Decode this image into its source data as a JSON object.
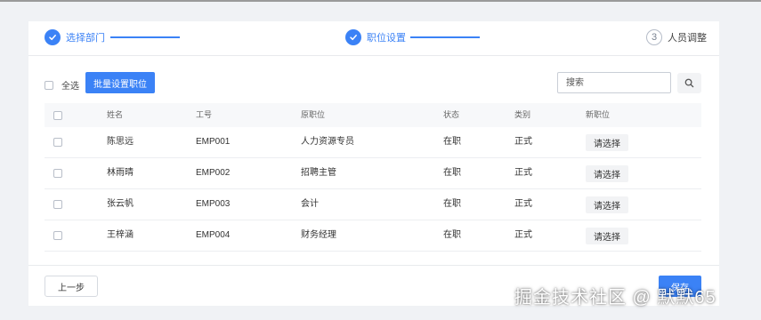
{
  "colors": {
    "primary": "#3b82f6",
    "pending_circle": "#b5bcc8",
    "background": "#f0f2f5",
    "card": "#ffffff"
  },
  "steps": [
    {
      "label": "选择部门",
      "status": "done",
      "icon": "check-icon"
    },
    {
      "label": "职位设置",
      "status": "done",
      "icon": "check-icon"
    },
    {
      "label": "人员调整",
      "status": "current",
      "number": "3"
    }
  ],
  "toolbar": {
    "select_all_label": "全选",
    "batch_button": "批量设置职位",
    "search_placeholder": "搜索",
    "search_icon": "search-icon"
  },
  "table": {
    "columns": [
      "姓名",
      "工号",
      "原职位",
      "状态",
      "类别",
      "新职位"
    ],
    "rows": [
      {
        "name": "陈思远",
        "id": "EMP001",
        "old_position": "人力资源专员",
        "status": "在职",
        "category": "正式",
        "new_position": "请选择"
      },
      {
        "name": "林雨晴",
        "id": "EMP002",
        "old_position": "招聘主管",
        "status": "在职",
        "category": "正式",
        "new_position": "请选择"
      },
      {
        "name": "张云帆",
        "id": "EMP003",
        "old_position": "会计",
        "status": "在职",
        "category": "正式",
        "new_position": "请选择"
      },
      {
        "name": "王梓涵",
        "id": "EMP004",
        "old_position": "财务经理",
        "status": "在职",
        "category": "正式",
        "new_position": "请选择"
      }
    ]
  },
  "footer": {
    "prev_button": "上一步",
    "save_button": "保存"
  },
  "watermark": "掘金技术社区 @ 默默65"
}
